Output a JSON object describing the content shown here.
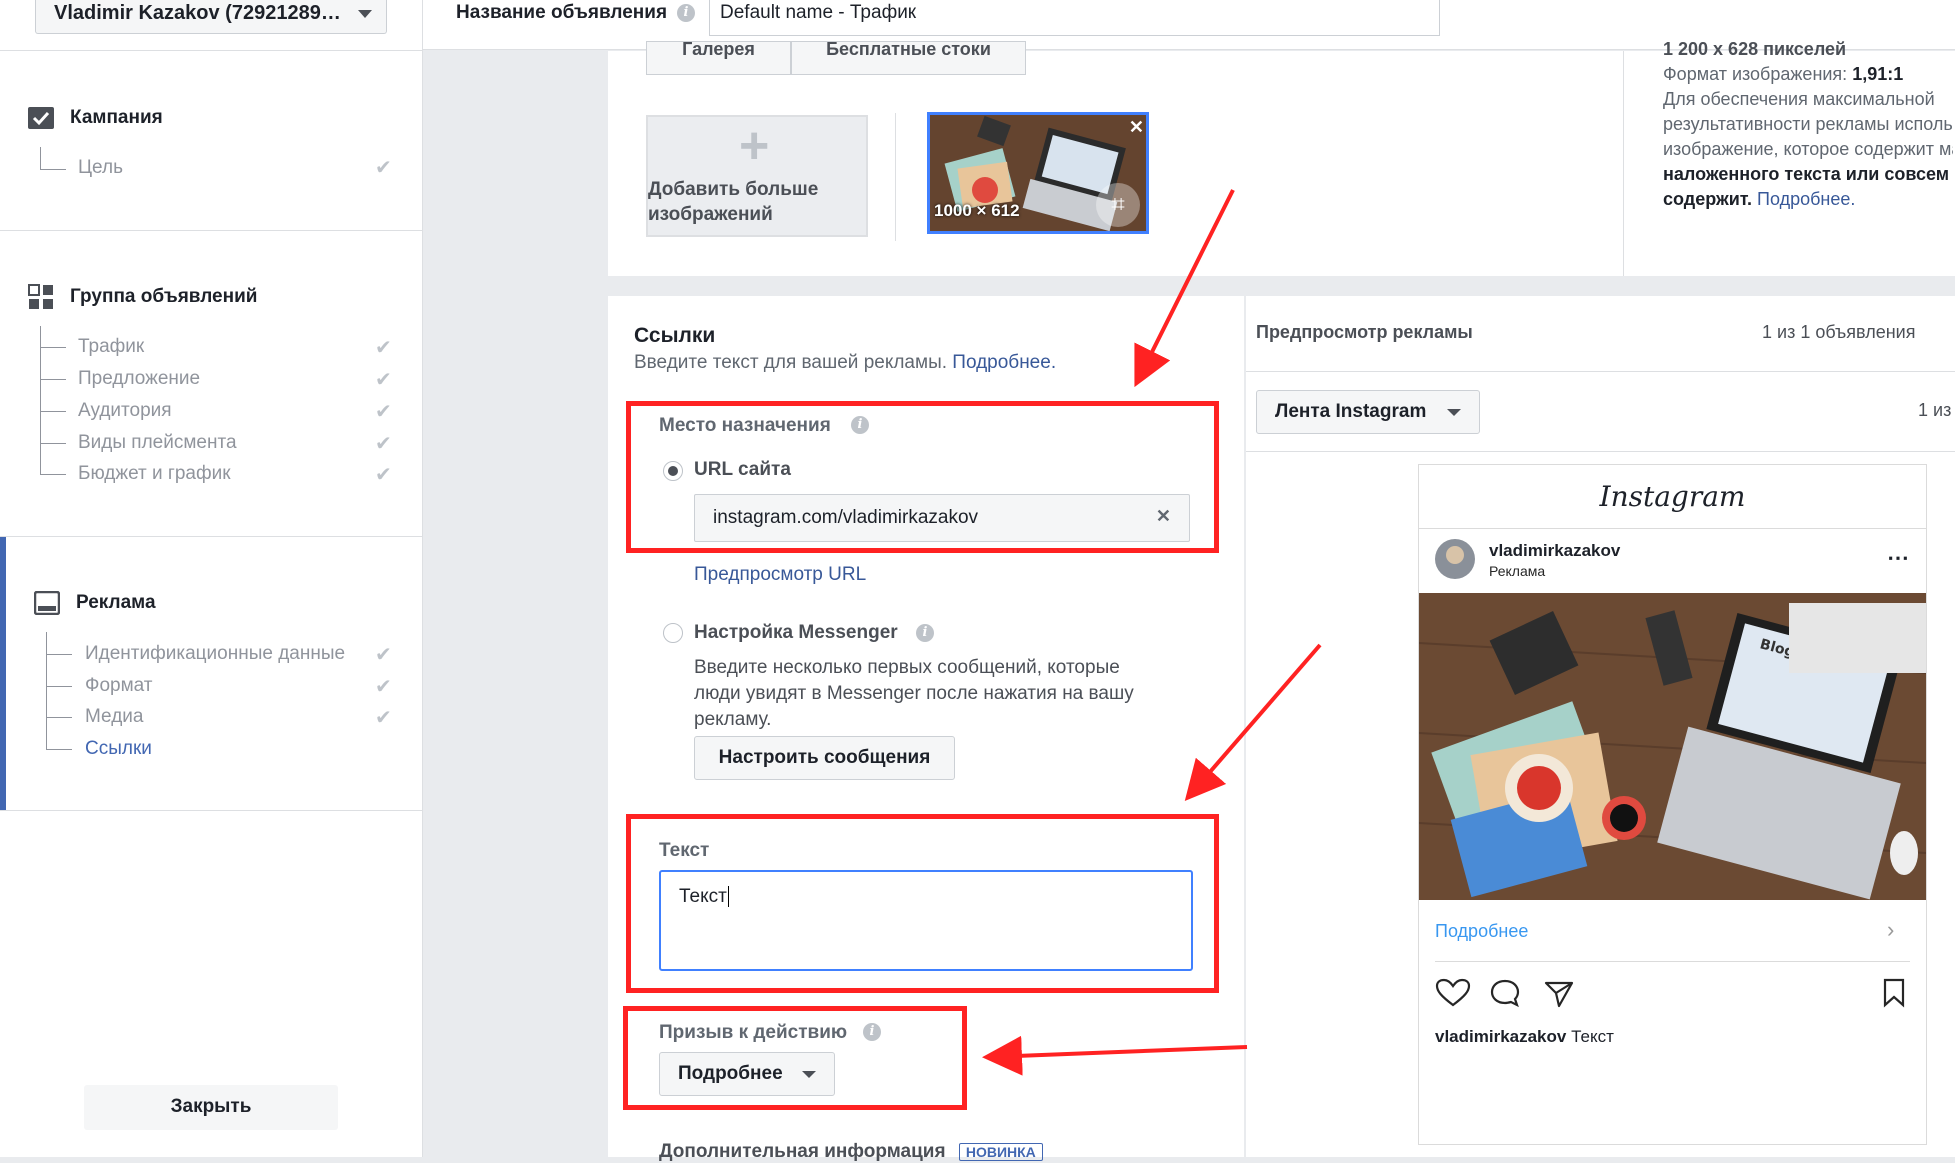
{
  "account": {
    "name": "Vladimir Kazakov (72921289…"
  },
  "sidebar": {
    "campaign": {
      "title": "Кампания",
      "items": [
        {
          "label": "Цель"
        }
      ]
    },
    "adset": {
      "title": "Группа объявлений",
      "items": [
        {
          "label": "Трафик"
        },
        {
          "label": "Предложение"
        },
        {
          "label": "Аудитория"
        },
        {
          "label": "Виды плейсмента"
        },
        {
          "label": "Бюджет и график"
        }
      ]
    },
    "ad": {
      "title": "Реклама",
      "items": [
        {
          "label": "Идентификационные данные"
        },
        {
          "label": "Формат"
        },
        {
          "label": "Медиа"
        },
        {
          "label": "Ссылки"
        }
      ]
    },
    "close_label": "Закрыть"
  },
  "topbar": {
    "ad_name_label": "Название объявления",
    "ad_name_value": "Default name - Трафик"
  },
  "media": {
    "add_more_label": "Добавить больше изображений",
    "thumb_size": "1000 × 612",
    "tab1": "Галерея",
    "tab2": "Бесплатные стоки",
    "spec_size": "1 200 x 628 пикселей",
    "spec_ratio_label": "Формат изображения:",
    "spec_ratio_value": "1,91:1",
    "spec_note_1": "Для обеспечения максимальной",
    "spec_note_2": "результативности рекламы используйте",
    "spec_note_3": "изображение, которое содержит мало",
    "spec_note_4": "наложенного текста или совсем его не",
    "spec_note_5": "содержит.",
    "spec_more": "Подробнее."
  },
  "links": {
    "title": "Ссылки",
    "subtitle": "Введите текст для вашей рекламы.",
    "subtitle_link": "Подробнее.",
    "destination_label": "Место назначения",
    "url_option": "URL сайта",
    "url_value": "instagram.com/vladimirkazakov",
    "url_preview": "Предпросмотр URL",
    "messenger_option": "Настройка Messenger",
    "messenger_desc_1": "Введите несколько первых сообщений, которые",
    "messenger_desc_2": "люди увидят в Messenger после нажатия на вашу",
    "messenger_desc_3": "рекламу.",
    "messenger_button": "Настроить сообщения",
    "text_label": "Текст",
    "text_value": "Текст",
    "cta_label": "Призыв к действию",
    "cta_value": "Подробнее",
    "more_info_label": "Дополнительная информация",
    "new_badge": "НОВИНКА"
  },
  "preview": {
    "title": "Предпросмотр рекламы",
    "count": "1 из 1 объявления",
    "placement": "Лента Instagram",
    "page_count": "1 из",
    "ig_logo": "Instagram",
    "username": "vladimirkazakov",
    "sponsored": "Реклама",
    "cta": "Подробнее",
    "caption_user": "vladimirkazakov",
    "caption_text": "Текст",
    "image_text": "Blog"
  }
}
